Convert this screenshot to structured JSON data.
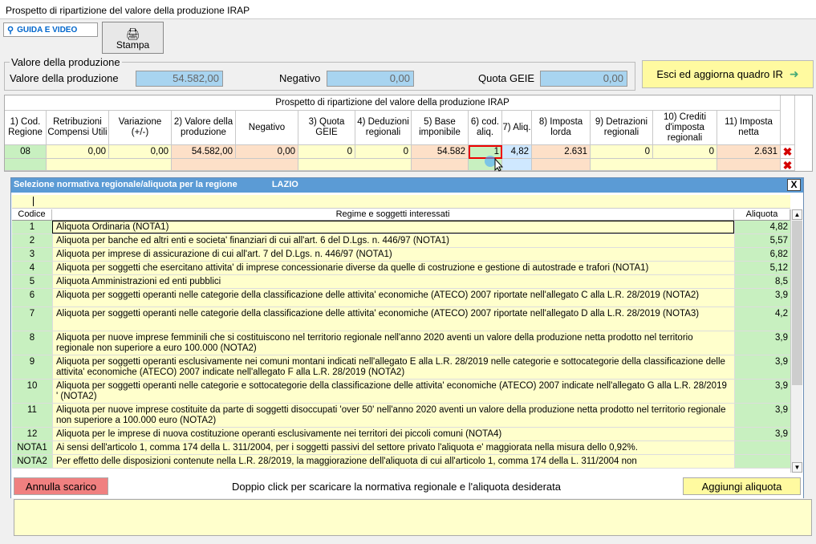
{
  "window": {
    "title": "Prospetto di ripartizione del valore della produzione IRAP"
  },
  "toolbar": {
    "guida_label": "GUIDA E VIDEO",
    "stampa_label": "Stampa"
  },
  "valore": {
    "legend": "Valore della produzione",
    "label": "Valore della produzione",
    "value": "54.582,00",
    "negativo_label": "Negativo",
    "negativo_value": "0,00",
    "geie_label": "Quota GEIE",
    "geie_value": "0,00"
  },
  "esci_label": "Esci ed aggiorna quadro IR",
  "grid": {
    "title": "Prospetto di ripartizione del valore della produzione IRAP",
    "headers": [
      "1) Cod. Regione",
      "Retribuzioni Compensi Utili",
      "Variazione (+/-)",
      "2) Valore della produzione",
      "Negativo",
      "3) Quota GEIE",
      "4) Deduzioni regionali",
      "5) Base imponibile",
      "6) cod. aliq.",
      "7) Aliq.",
      "8) Imposta lorda",
      "9) Detrazioni regionali",
      "10) Crediti d'imposta regionali",
      "11) Imposta netta"
    ],
    "row": [
      "08",
      "0,00",
      "0,00",
      "54.582,00",
      "0,00",
      "0",
      "0",
      "54.582",
      "1",
      "4,82",
      "2.631",
      "0",
      "0",
      "2.631"
    ]
  },
  "popup": {
    "title": "Selezione normativa regionale/aliquota per la regione",
    "region": "LAZIO",
    "close": "X",
    "col_codice": "Codice",
    "col_regime": "Regime e soggetti interessati",
    "col_aliquota": "Aliquota",
    "rows": [
      {
        "code": "1",
        "desc": "Aliquota Ordinaria (NOTA1)",
        "aliq": "4,82"
      },
      {
        "code": "2",
        "desc": "Aliquota per banche ed altri enti e societa' finanziari di cui all'art. 6 del D.Lgs. n. 446/97 (NOTA1)",
        "aliq": "5,57"
      },
      {
        "code": "3",
        "desc": "Aliquota per imprese di assicurazione di cui all'art. 7 del D.Lgs. n. 446/97 (NOTA1)",
        "aliq": "6,82"
      },
      {
        "code": "4",
        "desc": "Aliquota per soggetti che esercitano attivita' di imprese concessionarie diverse da quelle di costruzione e gestione di autostrade e trafori (NOTA1)",
        "aliq": "5,12"
      },
      {
        "code": "5",
        "desc": "Aliquota Amministrazioni ed enti pubblici",
        "aliq": "8,5"
      },
      {
        "code": "6",
        "desc": "Aliquota per soggetti operanti nelle categorie della classificazione delle attivita' economiche (ATECO) 2007 riportate nell'allegato C alla L.R. 28/2019 (NOTA2)",
        "aliq": "3,9"
      },
      {
        "code": "7",
        "desc": "Aliquota per soggetti operanti nelle categorie della classificazione delle attivita' economiche (ATECO) 2007 riportate nell'allegato D alla L.R. 28/2019 (NOTA3)",
        "aliq": "4,2"
      },
      {
        "code": "8",
        "desc": "Aliquota per nuove imprese femminili che si costituiscono nel territorio regionale nell'anno 2020 aventi un valore della produzione netta prodotto nel territorio regionale non superiore a euro 100.000 (NOTA2)",
        "aliq": "3,9"
      },
      {
        "code": "9",
        "desc": "Aliquota per soggetti operanti esclusivamente nei comuni montani indicati nell'allegato E alla L.R. 28/2019 nelle categorie e sottocategorie della classificazione delle attivita' economiche (ATECO) 2007 indicate nell'allegato F alla L.R. 28/2019 (NOTA2)",
        "aliq": "3,9"
      },
      {
        "code": "10",
        "desc": "Aliquota per soggetti operanti nelle categorie e sottocategorie della classificazione delle attivita' economiche (ATECO) 2007 indicate nell'allegato G alla L.R. 28/2019 ' (NOTA2)",
        "aliq": "3,9"
      },
      {
        "code": "11",
        "desc": "Aliquota per nuove imprese costituite da parte di soggetti disoccupati 'over 50' nell'anno 2020 aventi un valore della produzione netta prodotto nel territorio regionale non superiore a 100.000 euro (NOTA2)",
        "aliq": "3,9"
      },
      {
        "code": "12",
        "desc": "Aliquota per le imprese di nuova costituzione operanti esclusivamente nei territori dei piccoli comuni (NOTA4)",
        "aliq": "3,9"
      },
      {
        "code": "NOTA1",
        "desc": "Ai sensi dell'articolo 1, comma 174 della L. 311/2004, per i soggetti passivi del settore privato l'aliquota e' maggiorata nella misura dello 0,92%.",
        "aliq": ""
      },
      {
        "code": "NOTA2",
        "desc": "Per effetto delle disposizioni contenute nella L.R. 28/2019, la maggiorazione dell'aliquota di cui all'articolo 1, comma 174 della L. 311/2004 non",
        "aliq": ""
      }
    ],
    "annulla_label": "Annulla scarico",
    "hint": "Doppio click per scaricare la normativa regionale e l'aliquota desiderata",
    "aggiungi_label": "Aggiungi aliquota"
  }
}
